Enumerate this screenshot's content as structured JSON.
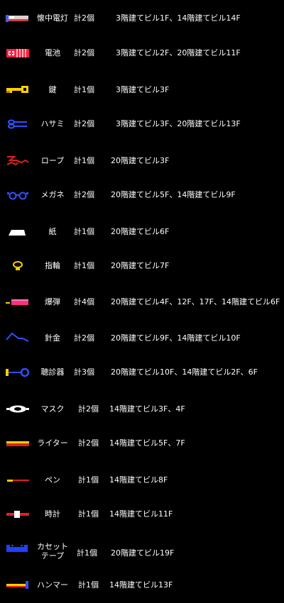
{
  "items": [
    {
      "icon": "flashlight-icon",
      "name": "懐中電灯",
      "count": "計2個",
      "location": "3階建てビル1F、14階建てビル14F"
    },
    {
      "icon": "battery-icon",
      "name": "電池",
      "count": "計2個",
      "location": "3階建てビル2F、20階建てビル11F"
    },
    {
      "icon": "key-icon",
      "name": "鍵",
      "count": "計1個",
      "location": "3階建てビル3F"
    },
    {
      "icon": "scissors-icon",
      "name": "ハサミ",
      "count": "計2個",
      "location": "3階建てビル3F、20階建てビル13F"
    },
    {
      "icon": "rope-icon",
      "name": "ロープ",
      "count": "計1個",
      "location": "20階建てビル3F"
    },
    {
      "icon": "glasses-icon",
      "name": "メガネ",
      "count": "計2個",
      "location": "20階建てビル5F、14階建てビル9F"
    },
    {
      "icon": "paper-icon",
      "name": "紙",
      "count": "計1個",
      "location": "20階建てビル6F"
    },
    {
      "icon": "ring-icon",
      "name": "指輪",
      "count": "計1個",
      "location": "20階建てビル7F"
    },
    {
      "icon": "dynamite-icon",
      "name": "爆弾",
      "count": "計4個",
      "location": "20階建てビル4F、12F、17F、14階建てビル6F"
    },
    {
      "icon": "wire-icon",
      "name": "針金",
      "count": "計2個",
      "location": "20階建てビル9F、14階建てビル10F"
    },
    {
      "icon": "stethoscope-icon",
      "name": "聴診器",
      "count": "計3個",
      "location": "20階建てビル10F、14階建てビル2F、6F"
    },
    {
      "icon": "mask-icon",
      "name": "マスク",
      "count": "計2個",
      "location": "14階建てビル3F、4F"
    },
    {
      "icon": "lighter-icon",
      "name": "ライター",
      "count": "計2個",
      "location": "14階建てビル5F、7F"
    },
    {
      "icon": "pen-icon",
      "name": "ペン",
      "count": "計1個",
      "location": "14階建てビル8F"
    },
    {
      "icon": "watch-icon",
      "name": "時計",
      "count": "計1個",
      "location": "14階建てビル11F"
    },
    {
      "icon": "cassette-tape-icon",
      "name": "カセット\nテープ",
      "count": "計1個",
      "location": "20階建てビル19F"
    },
    {
      "icon": "hammer-icon",
      "name": "ハンマー",
      "count": "計1個",
      "location": "14階建てビル13F"
    }
  ]
}
